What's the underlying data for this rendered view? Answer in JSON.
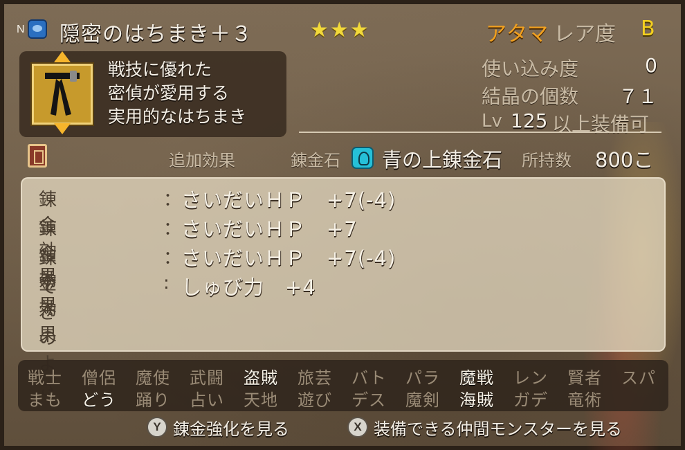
{
  "header": {
    "n_mark": "N",
    "item_name": "隠密のはちまき＋３",
    "stars": "★★★",
    "slot": "アタマ",
    "rarity_label": "レア度",
    "rarity_value": "B",
    "icon": "helmet-category-icon"
  },
  "description": {
    "lines": [
      "戦技に優れた",
      "密偵が愛用する",
      "実用的なはちまき"
    ],
    "thumb_icon": "black-headband-icon"
  },
  "stats": {
    "usage_label": "使い込み度",
    "usage_value": "0",
    "crystal_label": "結晶の個数",
    "crystal_value": "７１",
    "lv_prefix": "Lv",
    "lv_value": "125",
    "lv_suffix": "以上装備可"
  },
  "alchemy": {
    "add_effect_label": "追加効果",
    "stone_label": "錬金石",
    "stone_name": "青の上錬金石",
    "owned_label": "所持数",
    "owned_value": "800こ"
  },
  "effects": [
    {
      "label": "錬金効果",
      "colon": "：",
      "value": "さいだいＨＰ　+7(-4)"
    },
    {
      "label": "錬金効果",
      "colon": "：",
      "value": "さいだいＨＰ　+7"
    },
    {
      "label": "錬金効果",
      "colon": "：",
      "value": "さいだいＨＰ　+7(-4)"
    },
    {
      "label": "できのよさ",
      "colon": ":",
      "value": "しゅび力　+4"
    }
  ],
  "jobs_row1": [
    {
      "name": "戦士",
      "on": false
    },
    {
      "name": "僧侶",
      "on": false
    },
    {
      "name": "魔使",
      "on": false
    },
    {
      "name": "武闘",
      "on": false
    },
    {
      "name": "盗賊",
      "on": true
    },
    {
      "name": "旅芸",
      "on": false
    },
    {
      "name": "バト",
      "on": false
    },
    {
      "name": "パラ",
      "on": false
    },
    {
      "name": "魔戦",
      "on": true
    },
    {
      "name": "レン",
      "on": false
    },
    {
      "name": "賢者",
      "on": false
    },
    {
      "name": "スパ",
      "on": false
    }
  ],
  "jobs_row2": [
    {
      "name": "まも",
      "on": false
    },
    {
      "name": "どう",
      "on": true
    },
    {
      "name": "踊り",
      "on": false
    },
    {
      "name": "占い",
      "on": false
    },
    {
      "name": "天地",
      "on": false
    },
    {
      "name": "遊び",
      "on": false
    },
    {
      "name": "デス",
      "on": false
    },
    {
      "name": "魔剣",
      "on": false
    },
    {
      "name": "海賊",
      "on": true
    },
    {
      "name": "ガデ",
      "on": false
    },
    {
      "name": "竜術",
      "on": false
    }
  ],
  "footer": {
    "y_button": "Y",
    "y_label": "錬金強化を見る",
    "x_button": "X",
    "x_label": "装備できる仲間モンスターを見る"
  },
  "colors": {
    "slot_orange": "#f0a020",
    "star_yellow": "#f2d93a",
    "rarity_yellow": "#f4d020",
    "stone_cyan": "#26c0d8"
  }
}
